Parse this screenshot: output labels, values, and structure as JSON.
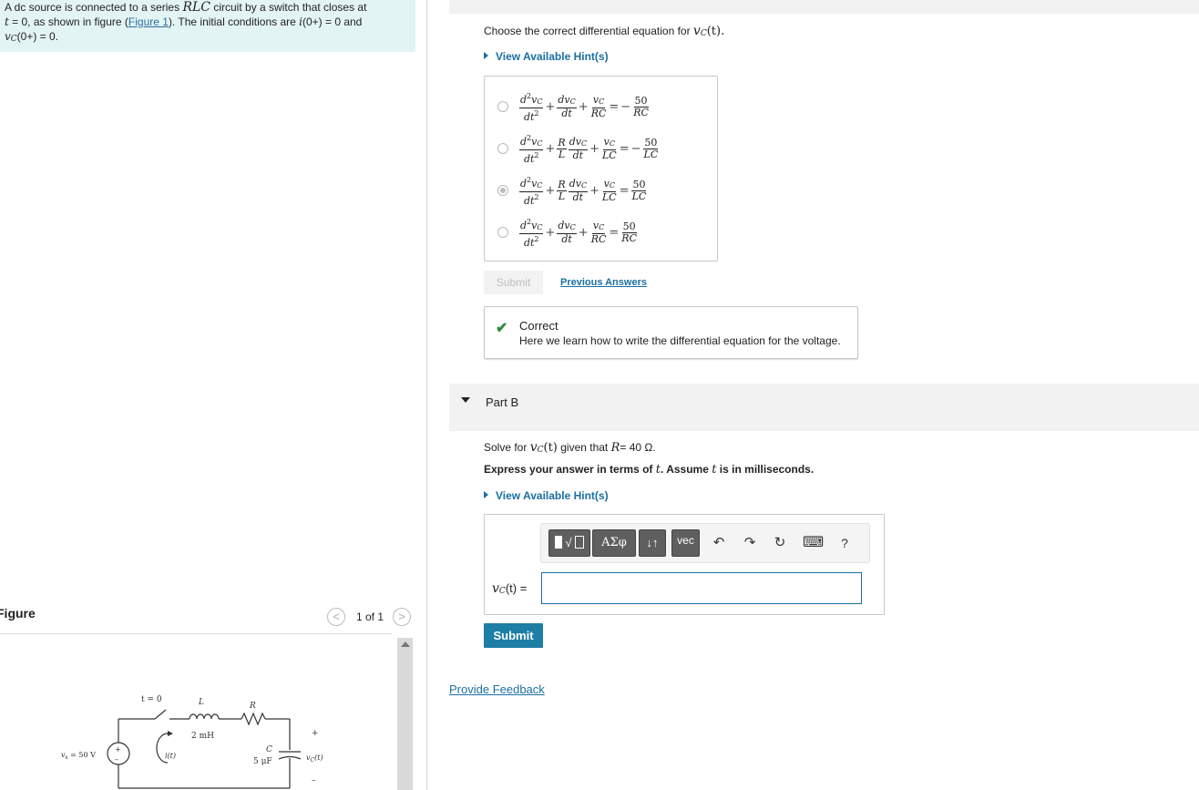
{
  "problem": {
    "line1_pre": "A dc source is connected to a series ",
    "line1_math": "RLC",
    "line1_post": " circuit by a switch that closes at",
    "line2_t": "t",
    "line2_a": " = 0, as shown in figure (",
    "line2_link": "Figure 1",
    "line2_b": "). The initial conditions are ",
    "line2_i": "i",
    "line2_c": "(0+) = 0 and",
    "line3_v": "v",
    "line3_sub": "C",
    "line3_rest": "(0+) = 0."
  },
  "figure": {
    "label": "Figure",
    "pager": "1 of 1",
    "prev": "<",
    "next": ">",
    "circuit": {
      "switch": "t = 0",
      "inductor_name": "L",
      "inductor_value": "2 mH",
      "resistor_name": "R",
      "capacitor_name": "C",
      "capacitor_value": "5 μF",
      "source": "v",
      "source_sub": "s",
      "source_value": " = 50 V",
      "current": "i(t)",
      "plus": "+",
      "minus": "–",
      "vc": "v",
      "vc_sub": "C",
      "vc_arg": "(t)"
    }
  },
  "partA": {
    "question_pre": "Choose the correct differential equation for ",
    "question_v": "v",
    "question_sub": "C",
    "question_post": "(t).",
    "hint": "View Available Hint(s)",
    "options": [
      {
        "id": "opt-1",
        "selected": false
      },
      {
        "id": "opt-2",
        "selected": false
      },
      {
        "id": "opt-3",
        "selected": true
      },
      {
        "id": "opt-4",
        "selected": false
      }
    ],
    "submit": "Submit",
    "previous_answers": "Previous Answers",
    "feedback_title": "Correct",
    "feedback_text": "Here we learn how to write the differential equation for the voltage."
  },
  "partB": {
    "label": "Part B",
    "q_pre": "Solve for ",
    "q_v": "v",
    "q_sub": "C",
    "q_mid": "(t)",
    "q_given": " given that ",
    "q_R": "R",
    "q_val": "= 40 Ω.",
    "express_pre": "Express your answer in terms of ",
    "express_t": "t",
    "express_mid": ". Assume ",
    "express_t2": "t",
    "express_post": " is in milliseconds.",
    "hint": "View Available Hint(s)",
    "toolbar": {
      "templates": "√",
      "greek": "ΑΣφ",
      "arrows": "↓↑",
      "vec": "vec",
      "undo": "↶",
      "redo": "↷",
      "reset": "↻",
      "keyboard": "⌨",
      "help": "?"
    },
    "answer_v": "v",
    "answer_sub": "C",
    "answer_rest": "(t) =",
    "answer_value": "",
    "submit": "Submit"
  },
  "provide_feedback": "Provide Feedback",
  "colors": {
    "link": "#1a6fa3",
    "submit_active": "#1d7ea6",
    "problem_bg": "#e3f4f5",
    "correct": "#2e8b3e"
  }
}
